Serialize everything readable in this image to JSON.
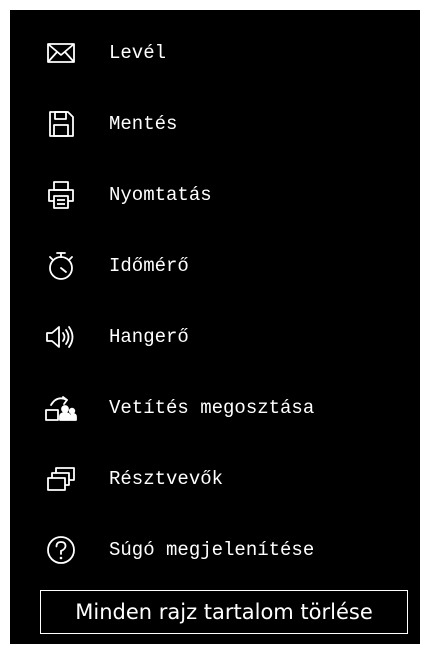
{
  "menu": {
    "items": [
      {
        "label": "Levél",
        "icon": "envelope-icon"
      },
      {
        "label": "Mentés",
        "icon": "floppy-disk-icon"
      },
      {
        "label": "Nyomtatás",
        "icon": "printer-icon"
      },
      {
        "label": "Időmérő",
        "icon": "stopwatch-icon"
      },
      {
        "label": "Hangerő",
        "icon": "speaker-volume-icon"
      },
      {
        "label": "Vetítés megosztása",
        "icon": "share-projection-icon"
      },
      {
        "label": "Résztvevők",
        "icon": "participants-windows-icon"
      },
      {
        "label": "Súgó megjelenítése",
        "icon": "help-question-icon"
      }
    ]
  },
  "actions": {
    "clear_label": "Minden rajz tartalom törlése"
  },
  "colors": {
    "background": "#000000",
    "foreground": "#ffffff",
    "page": "#ffffff"
  }
}
